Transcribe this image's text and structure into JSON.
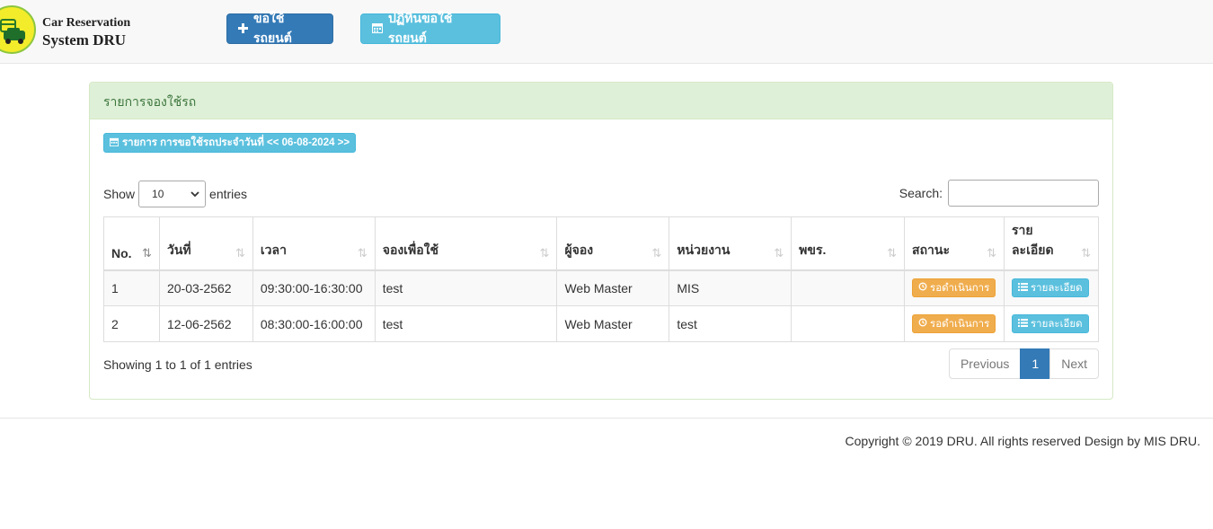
{
  "brand": {
    "line1": "Car Reservation",
    "line2": "System DRU"
  },
  "nav": {
    "request_car": "ขอใช้รถยนต์",
    "calendar": "ปฏิทินขอใช้รถยนต์"
  },
  "panel": {
    "heading": "รายการจองใช้รถ",
    "date_label": "รายการ การขอใช้รถประจำวันที่ << 06-08-2024 >>"
  },
  "datatable": {
    "show_label": "Show",
    "length_value": "10",
    "entries_label": "entries",
    "search_label": "Search:",
    "search_value": "",
    "columns": [
      "No.",
      "วันที่",
      "เวลา",
      "จองเพื่อใช้",
      "ผู้จอง",
      "หน่วยงาน",
      "พขร.",
      "สถานะ",
      "ราย",
      "ละเอียด"
    ],
    "rows": [
      {
        "no": "1",
        "date": "20-03-2562",
        "time": "09:30:00-16:30:00",
        "purpose": "test",
        "booker": "Web Master",
        "unit": "MIS",
        "driver": "",
        "status": "รอดำเนินการ",
        "detail": "รายละเอียด"
      },
      {
        "no": "2",
        "date": "12-06-2562",
        "time": "08:30:00-16:00:00",
        "purpose": "test",
        "booker": "Web Master",
        "unit": "test",
        "driver": "",
        "status": "รอดำเนินการ",
        "detail": "รายละเอียด"
      }
    ],
    "info": "Showing 1 to 1 of 1 entries",
    "pager": {
      "previous": "Previous",
      "current": "1",
      "next": "Next"
    }
  },
  "footer": "Copyright © 2019 DRU. All rights reserved Design by MIS DRU.",
  "colors": {
    "primary": "#337ab7",
    "info": "#5bc0de",
    "warning": "#f0ad4e",
    "success_bg": "#dff0d8"
  },
  "icons": [
    "car-logo-icon",
    "plus-icon",
    "calendar-icon",
    "sort-icon",
    "history-icon",
    "list-icon",
    "chevron-down-icon"
  ]
}
